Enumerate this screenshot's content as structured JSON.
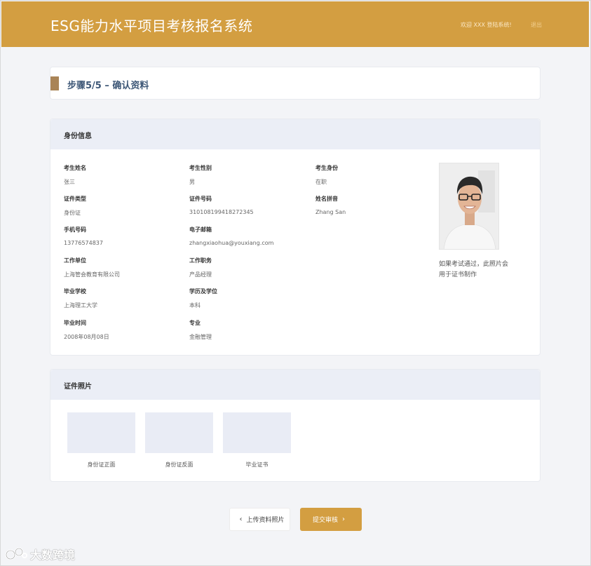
{
  "header": {
    "title": "ESG能力水平项目考核报名系统",
    "welcome": "欢迎 XXX 登陆系统!",
    "logout": "退出"
  },
  "step": {
    "title": "步骤5/5 – 确认资料"
  },
  "identity": {
    "section_title": "身份信息",
    "fields": [
      {
        "label": "考生姓名",
        "value": "张三"
      },
      {
        "label": "考生性别",
        "value": "男"
      },
      {
        "label": "考生身份",
        "value": "在职"
      },
      {
        "label": "证件类型",
        "value": "身份证"
      },
      {
        "label": "证件号码",
        "value": "310108199418272345"
      },
      {
        "label": "姓名拼音",
        "value": "Zhang San"
      },
      {
        "label": "手机号码",
        "value": "13776574837"
      },
      {
        "label": "电子邮箱",
        "value": "zhangxiaohua@youxiang.com"
      },
      {
        "label": "工作单位",
        "value": "上海管会教育有限公司"
      },
      {
        "label": "工作职务",
        "value": "产品经理"
      },
      {
        "label": "毕业学校",
        "value": "上海理工大学"
      },
      {
        "label": "学历及学位",
        "value": "本科"
      },
      {
        "label": "毕业时间",
        "value": "2008年08月08日"
      },
      {
        "label": "专业",
        "value": "金融管理"
      }
    ],
    "photo_note": "如果考试通过，此照片会用于证书制作"
  },
  "certificates": {
    "section_title": "证件照片",
    "items": [
      {
        "label": "身份证正面"
      },
      {
        "label": "身份证反面"
      },
      {
        "label": "毕业证书"
      }
    ]
  },
  "buttons": {
    "prev": "上传资料照片",
    "submit": "提交审核"
  },
  "watermark": "大数跨境",
  "colors": {
    "brand": "#d39e41",
    "step_accent": "#a98457",
    "section_bg": "#ebeef6"
  }
}
